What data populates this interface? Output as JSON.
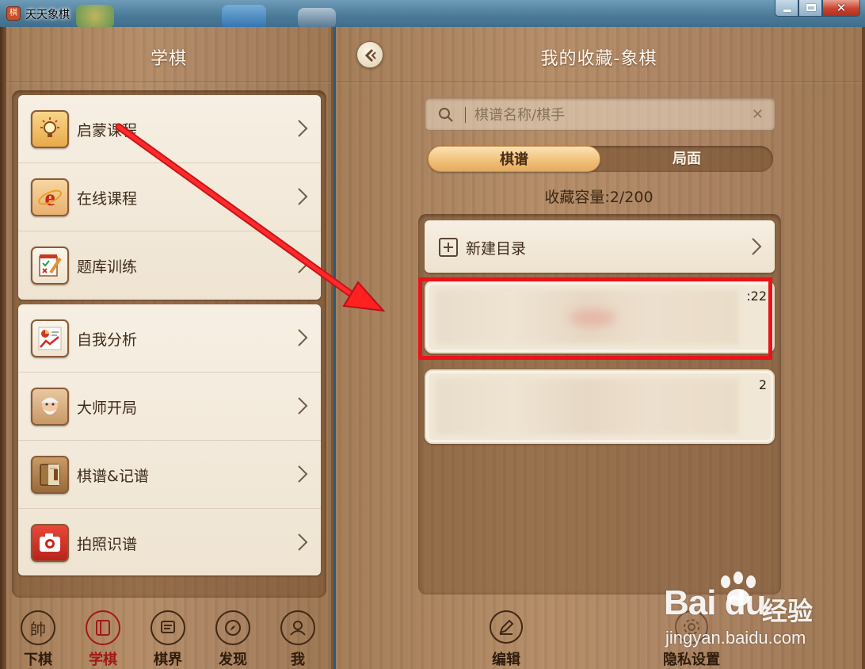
{
  "window": {
    "title": "天天象棋"
  },
  "left": {
    "title": "学棋",
    "menu_top": [
      {
        "label": "启蒙课程",
        "icon": "lightbulb-icon"
      },
      {
        "label": "在线课程",
        "icon": "ie-browser-icon"
      },
      {
        "label": "题库训练",
        "icon": "exercise-notebook-icon"
      }
    ],
    "menu_bottom": [
      {
        "label": "自我分析",
        "icon": "analysis-chart-icon"
      },
      {
        "label": "大师开局",
        "icon": "master-portrait-icon"
      },
      {
        "label": "棋谱&记谱",
        "icon": "record-book-icon"
      },
      {
        "label": "拍照识谱",
        "icon": "camera-icon"
      }
    ],
    "nav": [
      {
        "label": "下棋",
        "glyph": "帥",
        "active": false
      },
      {
        "label": "学棋",
        "glyph": "",
        "active": true
      },
      {
        "label": "棋界",
        "glyph": "",
        "active": false
      },
      {
        "label": "发现",
        "glyph": "",
        "active": false
      },
      {
        "label": "我",
        "glyph": "",
        "active": false
      }
    ]
  },
  "right": {
    "title": "我的收藏-象棋",
    "search": {
      "placeholder": "棋谱名称/棋手",
      "value": ""
    },
    "tabs": [
      {
        "label": "棋谱",
        "active": true
      },
      {
        "label": "局面",
        "active": false
      }
    ],
    "capacity": "收藏容量:2/200",
    "new_folder_label": "新建目录",
    "records": [
      {
        "time": ":22"
      },
      {
        "time": "2"
      }
    ],
    "bottom": [
      {
        "label": "编辑",
        "icon": "edit-pen-icon"
      },
      {
        "label": "隐私设置",
        "icon": "privacy-settings-icon"
      }
    ]
  },
  "colors": {
    "annotation_red": "#e8141a",
    "active_nav": "#a3161a",
    "tab_active": "#f0c27c"
  },
  "watermark": {
    "logo": "Bai du",
    "cn": "经验",
    "url": "jingyan.baidu.com"
  }
}
